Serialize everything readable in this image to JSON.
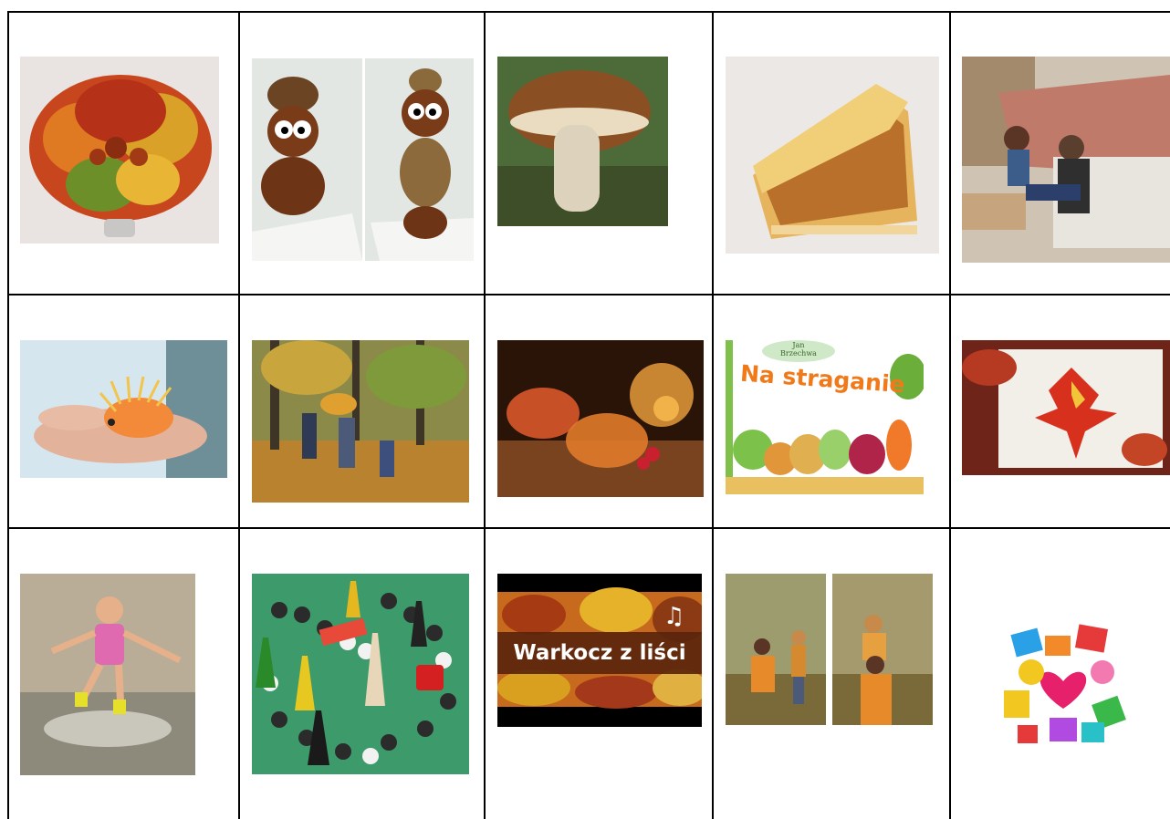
{
  "cells": {
    "r3c3": {
      "banner_text": "Warkocz z liści"
    },
    "r2c4": {
      "book_author": "Jan\nBrzechwa",
      "book_title": "Na straganie"
    }
  },
  "colors": {
    "grid_line": "#000000",
    "background": "#ffffff"
  }
}
